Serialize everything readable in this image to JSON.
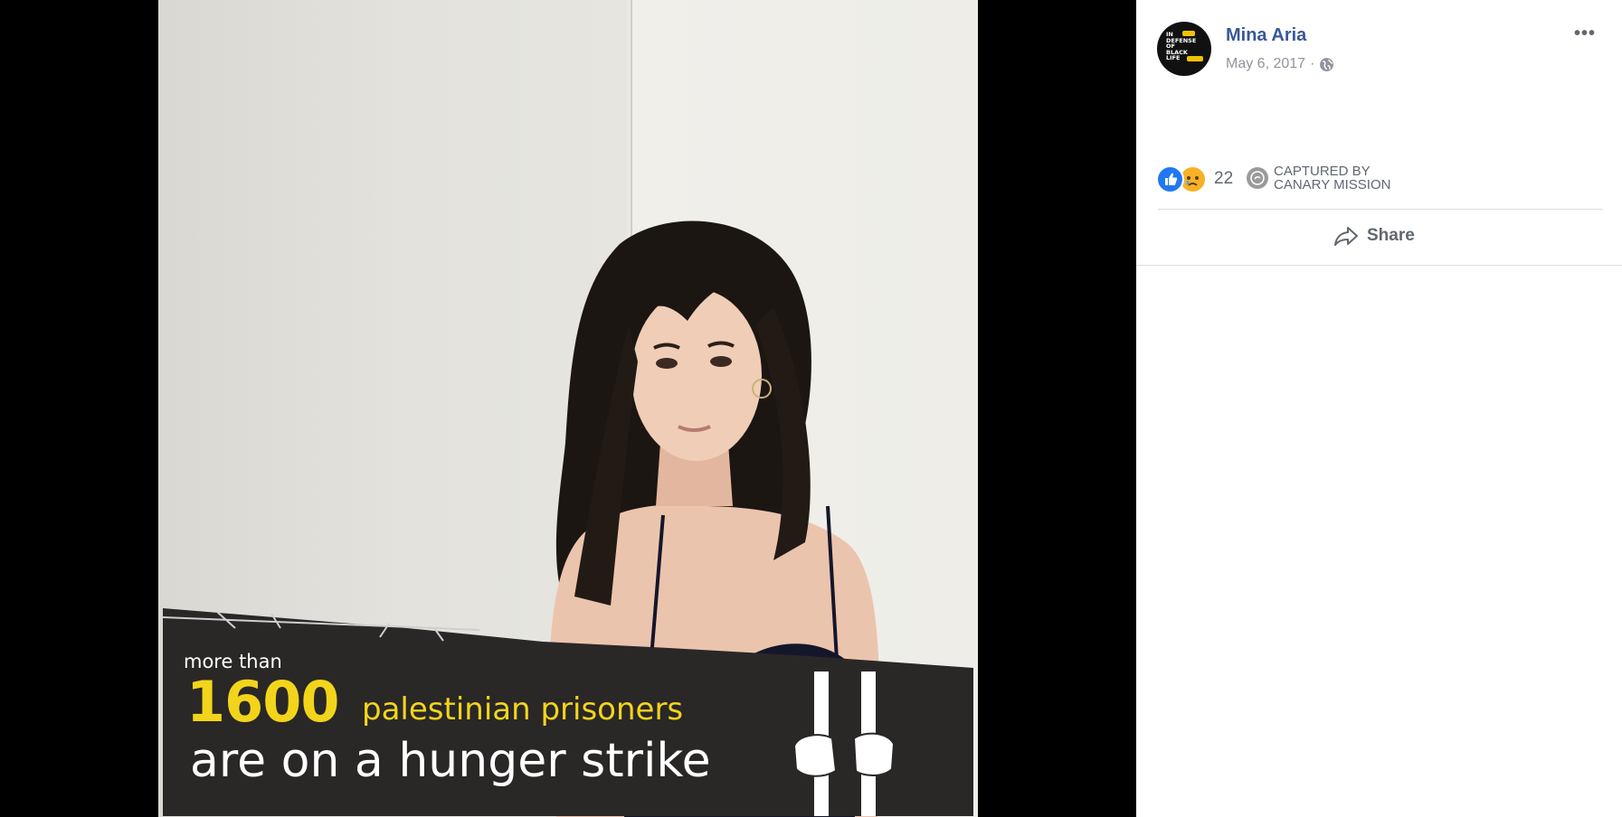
{
  "post": {
    "author": "Mina Aria",
    "date": "May 6, 2017",
    "date_separator": "·",
    "privacy_icon": "globe-icon",
    "more_label": "•••",
    "avatar_text": "IN\nDEFENSE\nOF\nBLACK\nLIFE"
  },
  "photo": {
    "banner": {
      "line1": "more than",
      "number": "1600",
      "line2": "palestinian prisoners",
      "line3": "are on a hunger strike"
    }
  },
  "reactions": {
    "types": [
      "like-icon",
      "sad-icon"
    ],
    "count": "22"
  },
  "captured": {
    "line1": "CAPTURED BY",
    "line2": "CANARY MISSION"
  },
  "actions": {
    "share_label": "Share"
  },
  "colors": {
    "link": "#385898",
    "secondary_text": "#90949c",
    "action_text": "#606770",
    "banner_yellow": "#f2d51b",
    "banner_bg": "#2a2727",
    "like_blue": "#2078f4"
  }
}
